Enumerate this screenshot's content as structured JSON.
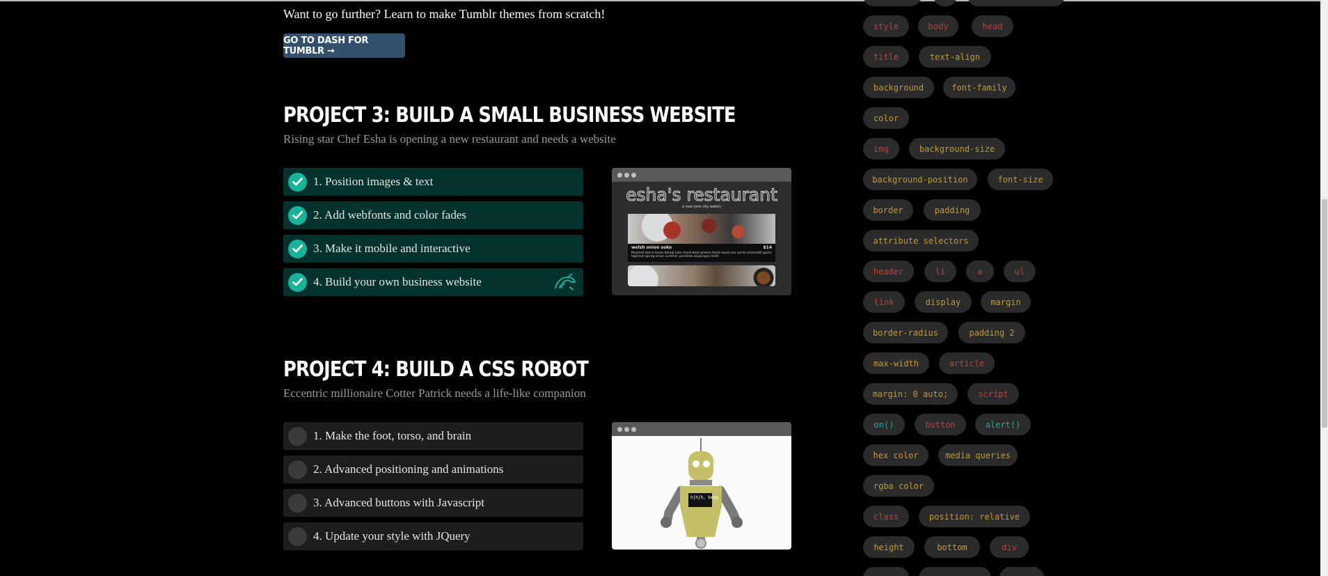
{
  "intro_text": "Want to go further? Learn to make Tumblr themes from scratch!",
  "dash_button": "GO TO DASH FOR TUMBLR →",
  "projects": [
    {
      "title": "PROJECT 3: BUILD A SMALL BUSINESS WEBSITE",
      "subtitle": "Rising star Chef Esha is opening a new restaurant and needs a website",
      "lessons": [
        {
          "label": "1. Position images & text",
          "completed": true
        },
        {
          "label": "2. Add webfonts and color fades",
          "completed": true
        },
        {
          "label": "3. Make it mobile and interactive",
          "completed": true
        },
        {
          "label": "4. Build your own business website",
          "completed": true
        }
      ],
      "preview": {
        "title": "esha's restaurant",
        "tagline": "a new york city eatery",
        "dish": "welsh onion soko",
        "price": "$14",
        "description": "Mustard sierra leone bologi kale chard beet greens black-eyed pea sorrel amaranth garlic tigernut spring onion summer purslane asparagus lentil."
      }
    },
    {
      "title": "PROJECT 4: BUILD A CSS ROBOT",
      "subtitle": "Eccentric millionaire Cotter Patrick needs a life-like companion",
      "lessons": [
        {
          "label": "1. Make the foot, torso, and brain",
          "completed": false
        },
        {
          "label": "2. Advanced positioning and animations",
          "completed": false
        },
        {
          "label": "3. Advanced buttons with Javascript",
          "completed": false
        },
        {
          "label": "4. Update your style with JQuery",
          "completed": false
        }
      ],
      "preview": {
        "screen_text": "hjhjh, bepp"
      }
    }
  ],
  "tags": [
    {
      "label": "style",
      "color": "red"
    },
    {
      "label": "body",
      "color": "red"
    },
    {
      "label": "head",
      "color": "red"
    },
    {
      "label": "title",
      "color": "red"
    },
    {
      "label": "text-align",
      "color": "gold"
    },
    {
      "label": "background",
      "color": "gold"
    },
    {
      "label": "font-family",
      "color": "gold"
    },
    {
      "label": "color",
      "color": "gold"
    },
    {
      "label": "img",
      "color": "red"
    },
    {
      "label": "background-size",
      "color": "gold"
    },
    {
      "label": "background-position",
      "color": "gold"
    },
    {
      "label": "font-size",
      "color": "gold"
    },
    {
      "label": "border",
      "color": "gold"
    },
    {
      "label": "padding",
      "color": "gold"
    },
    {
      "label": "attribute selectors",
      "color": "gold"
    },
    {
      "label": "header",
      "color": "red"
    },
    {
      "label": "li",
      "color": "red"
    },
    {
      "label": "a",
      "color": "red"
    },
    {
      "label": "ul",
      "color": "red"
    },
    {
      "label": "link",
      "color": "red"
    },
    {
      "label": "display",
      "color": "gold"
    },
    {
      "label": "margin",
      "color": "gold"
    },
    {
      "label": "border-radius",
      "color": "gold"
    },
    {
      "label": "padding 2",
      "color": "gold"
    },
    {
      "label": "max-width",
      "color": "gold"
    },
    {
      "label": "article",
      "color": "red"
    },
    {
      "label": "margin: 0 auto;",
      "color": "gold"
    },
    {
      "label": "script",
      "color": "red"
    },
    {
      "label": "on()",
      "color": "teal"
    },
    {
      "label": "button",
      "color": "red"
    },
    {
      "label": "alert()",
      "color": "teal"
    },
    {
      "label": "hex color",
      "color": "gold"
    },
    {
      "label": "media queries",
      "color": "gold"
    },
    {
      "label": "rgba color",
      "color": "gold"
    },
    {
      "label": "class",
      "color": "red"
    },
    {
      "label": "position: relative",
      "color": "gold"
    },
    {
      "label": "height",
      "color": "gold"
    },
    {
      "label": "bottom",
      "color": "gold"
    },
    {
      "label": "div",
      "color": "red"
    }
  ],
  "colors": {
    "completed_bg": "#04322d",
    "check_circle": "#19b39a",
    "tag_red": "#c0403a",
    "tag_gold": "#c79a2a",
    "tag_teal": "#1ea99a",
    "button_bg": "#34506d"
  }
}
